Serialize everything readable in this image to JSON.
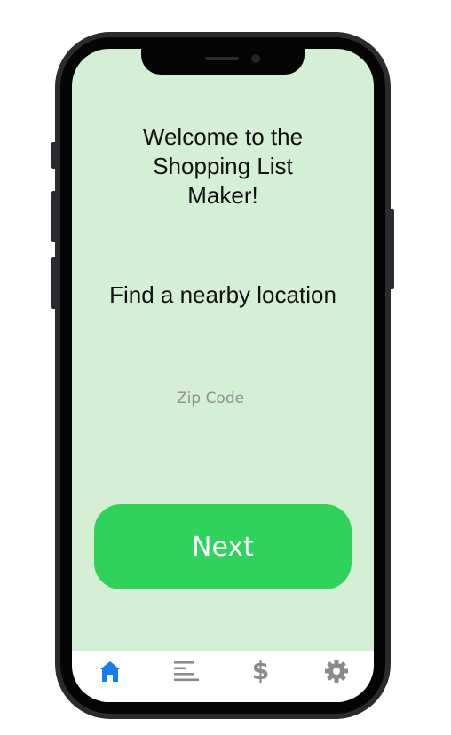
{
  "welcome_text": "Welcome to the Shopping List Maker!",
  "find_title": "Find a nearby location",
  "zip_input": {
    "placeholder": "Zip Code",
    "value": ""
  },
  "next_button_label": "Next",
  "tab_bar": {
    "active_tab": "home",
    "tabs": [
      {
        "id": "home",
        "icon": "home-icon",
        "color": "#1a7cf5"
      },
      {
        "id": "list",
        "icon": "list-icon",
        "color": "#8a8a8a"
      },
      {
        "id": "price",
        "icon": "dollar-icon",
        "glyph": "$",
        "color": "#8a8a8a"
      },
      {
        "id": "settings",
        "icon": "gear-icon",
        "color": "#8a8a8a"
      }
    ]
  },
  "colors": {
    "screen_background": "#d4efd4",
    "primary_button": "#2fd35b",
    "active_tab": "#1a7cf5",
    "inactive_tab": "#8a8a8a",
    "phone_frame": "#2b2b2f"
  }
}
